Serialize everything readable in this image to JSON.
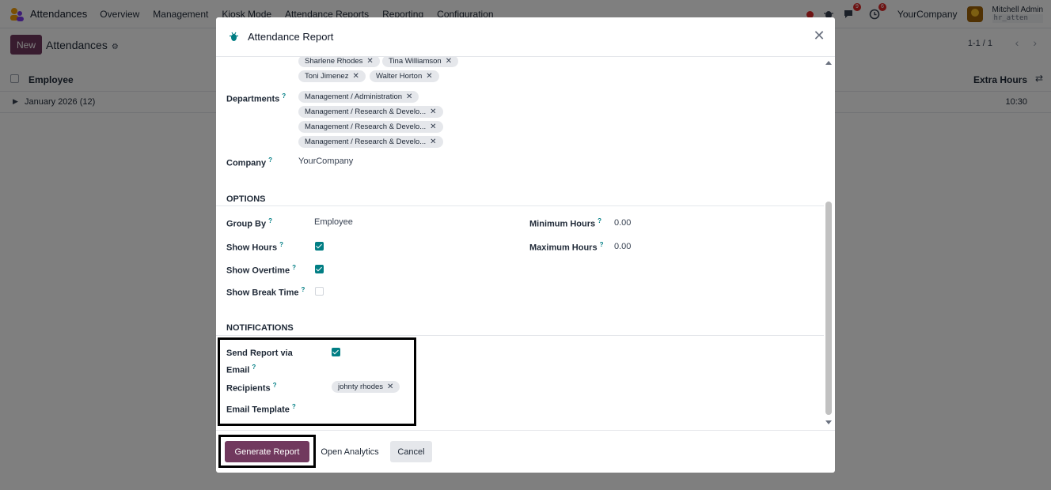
{
  "navbar": {
    "app_name": "Attendances",
    "menu": [
      "Overview",
      "Management",
      "Kiosk Mode",
      "Attendance Reports",
      "Reporting",
      "Configuration"
    ],
    "messages_badge": "9",
    "activities_badge": "6",
    "company": "YourCompany",
    "user_name": "Mitchell Admin",
    "user_db": "hr_atten"
  },
  "control": {
    "new_label": "New",
    "breadcrumb": "Attendances",
    "pager": "1-1 / 1"
  },
  "list": {
    "col_employee": "Employee",
    "col_extra_hours": "Extra Hours",
    "group_label": "January 2026 (12)",
    "group_value": "10:30"
  },
  "modal": {
    "title": "Attendance Report",
    "employee_tags": [
      "Sharlene Rhodes",
      "Tina Williamson",
      "Toni Jimenez",
      "Walter Horton"
    ],
    "departments_label": "Departments",
    "department_tags": [
      "Management / Administration",
      "Management / Research & Develo...",
      "Management / Research & Develo...",
      "Management / Research & Develo..."
    ],
    "company_label": "Company",
    "company_value": "YourCompany",
    "options_title": "OPTIONS",
    "group_by_label": "Group By",
    "group_by_value": "Employee",
    "show_hours_label": "Show Hours",
    "show_hours": true,
    "show_overtime_label": "Show Overtime",
    "show_overtime": true,
    "show_break_label": "Show Break Time",
    "show_break": false,
    "min_hours_label": "Minimum Hours",
    "min_hours_value": "0.00",
    "max_hours_label": "Maximum Hours",
    "max_hours_value": "0.00",
    "notifications_title": "NOTIFICATIONS",
    "send_report_label_1": "Send Report via",
    "send_report_label_2": "Email",
    "send_report": true,
    "recipients_label": "Recipients",
    "recipient_tag": "johnty rhodes",
    "email_template_label": "Email Template",
    "help_mark": "?"
  },
  "footer": {
    "generate": "Generate Report",
    "analytics": "Open Analytics",
    "cancel": "Cancel"
  },
  "colors": {
    "primary": "#71395e",
    "teal": "#017e84"
  }
}
